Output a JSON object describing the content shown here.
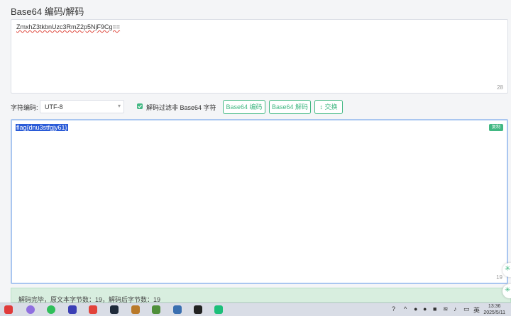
{
  "header": {
    "title": "Base64 编码/解码"
  },
  "input": {
    "value": "ZmxhZ3tkbnUzc3RmZ2p5NjF9Cg==",
    "count": "28"
  },
  "controls": {
    "encoding_label": "字符编码:",
    "encoding_value": "UTF-8",
    "filter_checked": true,
    "filter_label": "解码过滤非 Base64 字符",
    "encode_button": "Base64 编码",
    "decode_button": "Base64 解码",
    "swap_button": "↕ 交换"
  },
  "output": {
    "value": "flag{dnu3stfgjy61}",
    "copy_label": "复制",
    "count": "19"
  },
  "status": {
    "text": "解码完毕，原文本字节数：19，解码后字节数：19"
  },
  "taskbar": {
    "lang": "英",
    "time": "13:36",
    "date": "2025/5/11",
    "icons": [
      "windows-icon",
      "bot-icon",
      "wechat-icon",
      "app-icon",
      "wps-icon",
      "shield-app-icon",
      "box-app-icon",
      "image-app-icon",
      "notebook-app-icon",
      "beyond-compare-icon",
      "pycharm-icon"
    ]
  },
  "colors": {
    "accent": "#42b883",
    "selection": "#2a5bd7",
    "status_bg": "#d8eedf"
  }
}
